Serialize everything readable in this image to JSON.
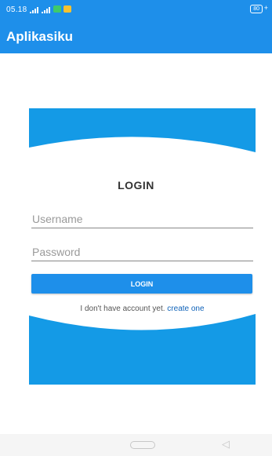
{
  "status_bar": {
    "time": "05.18",
    "battery": "80"
  },
  "app_bar": {
    "title": "Aplikasiku"
  },
  "login": {
    "heading": "LOGIN",
    "username_placeholder": "Username",
    "password_placeholder": "Password",
    "button_label": "LOGIN",
    "signup_prompt": "I don't have account yet.",
    "signup_link": "create one"
  },
  "colors": {
    "primary": "#1e8fea",
    "wave": "#149ae6",
    "link": "#0f62b8"
  }
}
